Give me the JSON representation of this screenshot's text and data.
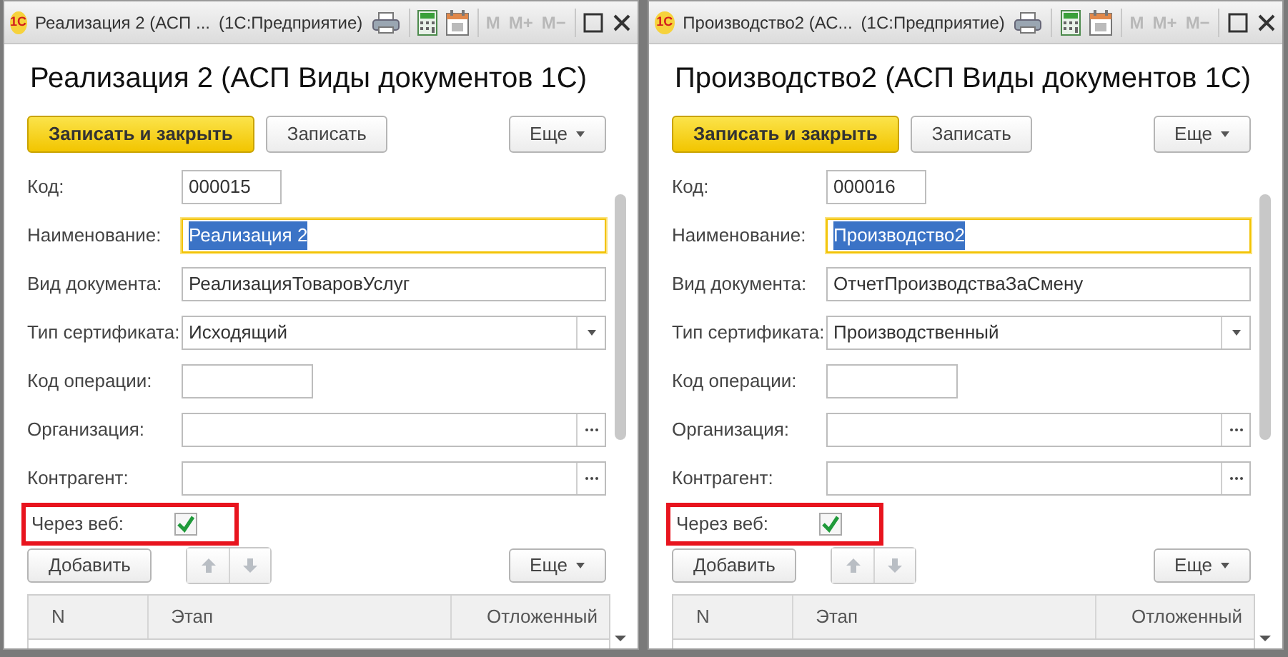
{
  "windows": [
    {
      "title_bar": {
        "title": "Реализация 2 (АСП ...",
        "app": "(1С:Предприятие)",
        "logo": "1С",
        "memory_buttons": [
          "M",
          "M+",
          "M−"
        ]
      },
      "heading": "Реализация 2 (АСП Виды документов 1С)",
      "toolbar": [
        {
          "label": "Записать и закрыть",
          "kind": "primary"
        },
        {
          "label": "Записать",
          "kind": "normal"
        },
        {
          "label": "Еще",
          "kind": "menu"
        }
      ],
      "fields": [
        {
          "label": "Код:",
          "value": "000015",
          "kind": "short"
        },
        {
          "label": "Наименование:",
          "value": "Реализация 2",
          "kind": "text",
          "focused": true
        },
        {
          "label": "Вид документа:",
          "value": "РеализацияТоваровУслуг",
          "kind": "text"
        },
        {
          "label": "Тип сертификата:",
          "value": "Исходящий",
          "kind": "dropdown"
        },
        {
          "label": "Код операции:",
          "kind": "medium"
        },
        {
          "label": "Организация:",
          "kind": "choice"
        },
        {
          "label": "Контрагент:",
          "kind": "choice"
        },
        {
          "label": "Через веб:",
          "kind": "checkbox",
          "checked": true,
          "highlighted": true
        }
      ],
      "table_toolbar": [
        {
          "label": "Добавить",
          "kind": "normal"
        },
        {
          "kind": "up",
          "disabled": true
        },
        {
          "kind": "down",
          "disabled": true
        },
        {
          "label": "Еще",
          "kind": "menu"
        }
      ],
      "table": {
        "columns": [
          "N",
          "Этап",
          "Отложенный"
        ]
      }
    },
    {
      "title_bar": {
        "title": "Производство2 (АС...",
        "app": "(1С:Предприятие)",
        "logo": "1С",
        "memory_buttons": [
          "M",
          "M+",
          "M−"
        ]
      },
      "heading": "Производство2 (АСП Виды документов 1С)",
      "toolbar": [
        {
          "label": "Записать и закрыть",
          "kind": "primary"
        },
        {
          "label": "Записать",
          "kind": "normal"
        },
        {
          "label": "Еще",
          "kind": "menu"
        }
      ],
      "fields": [
        {
          "label": "Код:",
          "value": "000016",
          "kind": "short"
        },
        {
          "label": "Наименование:",
          "value": "Производство2",
          "kind": "text",
          "focused": true
        },
        {
          "label": "Вид документа:",
          "value": "ОтчетПроизводстваЗаСмену",
          "kind": "text"
        },
        {
          "label": "Тип сертификата:",
          "value": "Производственный",
          "kind": "dropdown"
        },
        {
          "label": "Код операции:",
          "kind": "medium"
        },
        {
          "label": "Организация:",
          "kind": "choice"
        },
        {
          "label": "Контрагент:",
          "kind": "choice"
        },
        {
          "label": "Через веб:",
          "kind": "checkbox",
          "checked": true,
          "highlighted": true
        }
      ],
      "table_toolbar": [
        {
          "label": "Добавить",
          "kind": "normal"
        },
        {
          "kind": "up",
          "disabled": true
        },
        {
          "kind": "down",
          "disabled": true
        },
        {
          "label": "Еще",
          "kind": "menu"
        }
      ],
      "table": {
        "columns": [
          "N",
          "Этап",
          "Отложенный"
        ]
      }
    }
  ]
}
